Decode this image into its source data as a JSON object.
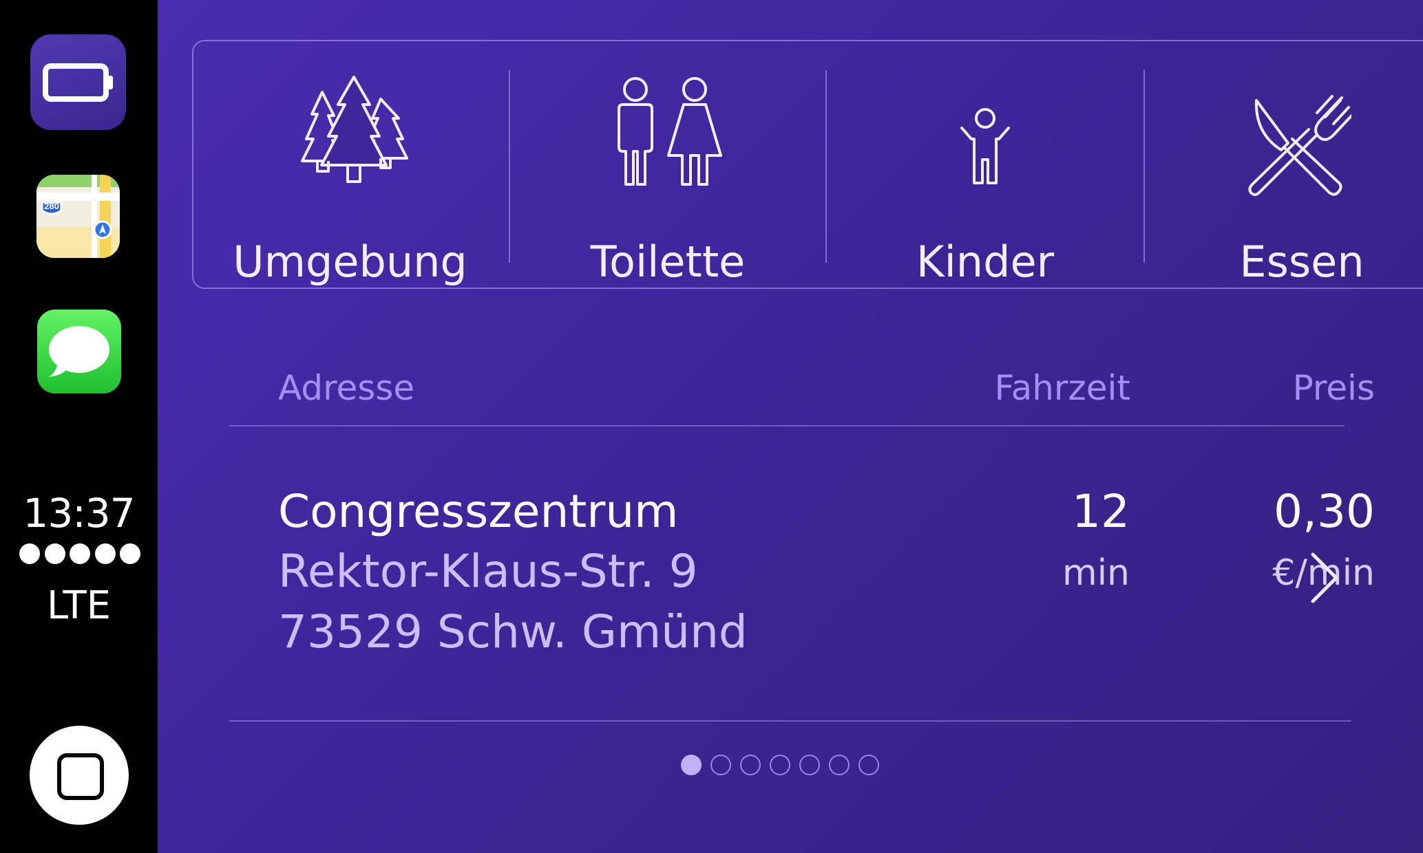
{
  "sidebar": {
    "apps": [
      {
        "name": "battery-app",
        "icon": "battery-icon"
      },
      {
        "name": "maps-app",
        "icon": "maps-icon",
        "shield": "280"
      },
      {
        "name": "messages-app",
        "icon": "messages-icon"
      }
    ],
    "clock": "13:37",
    "signal_bars": 5,
    "network": "LTE"
  },
  "categories": [
    {
      "label": "Umgebung",
      "icon": "trees-icon"
    },
    {
      "label": "Toilette",
      "icon": "toilet-icon"
    },
    {
      "label": "Kinder",
      "icon": "child-icon"
    },
    {
      "label": "Essen",
      "icon": "cutlery-icon"
    }
  ],
  "table": {
    "headers": {
      "address": "Adresse",
      "time": "Fahrzeit",
      "price": "Preis"
    },
    "rows": [
      {
        "name": "Congresszentrum",
        "street": "Rektor-Klaus-Str. 9",
        "city": "73529 Schw. Gmünd",
        "time_value": "12",
        "time_unit": "min",
        "price_value": "0,30",
        "price_unit": "€/min"
      }
    ]
  },
  "pagination": {
    "total": 7,
    "current": 1
  },
  "colors": {
    "accent": "#a490f2",
    "background_start": "#4a2cb0",
    "background_end": "#35207e",
    "maps_shield": "#2f64c9",
    "messages_green": "#2ed03e"
  }
}
